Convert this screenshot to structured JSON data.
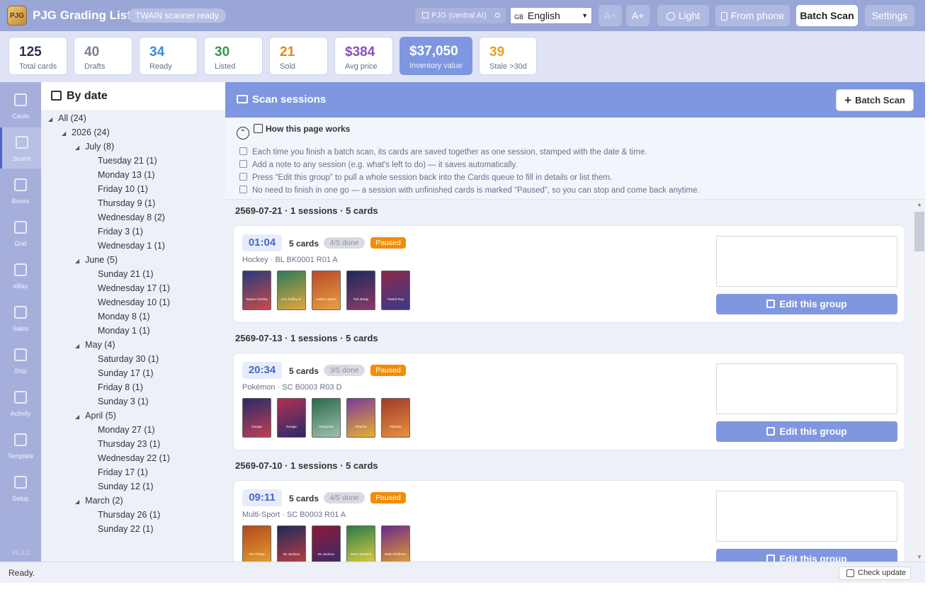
{
  "header": {
    "title": "PJG Grading List",
    "scanner_status": "TWAIN scanner ready",
    "model": "PJG (central AI)",
    "language": {
      "flag": "GB",
      "value": "English"
    },
    "font_decrease": "A−",
    "font_increase": "A+",
    "theme": "Light",
    "from_phone": "From phone",
    "batch_scan": "Batch Scan",
    "settings": "Settings"
  },
  "stats": [
    {
      "value": "125",
      "label": "Total cards",
      "color": "#2d3350"
    },
    {
      "value": "40",
      "label": "Drafts",
      "color": "#7a7f95"
    },
    {
      "value": "34",
      "label": "Ready",
      "color": "#2f8fdc"
    },
    {
      "value": "30",
      "label": "Listed",
      "color": "#2f9a4e"
    },
    {
      "value": "21",
      "label": "Sold",
      "color": "#e8860c"
    },
    {
      "value": "$384",
      "label": "Avg price",
      "color": "#8a4fb5"
    },
    {
      "value": "$37,050",
      "label": "Inventory value",
      "color": "#ffffff"
    },
    {
      "value": "39",
      "label": "Stale >30d",
      "color": "#e8a020"
    }
  ],
  "nav": {
    "items": [
      {
        "label": "Cards",
        "icon": "cards-icon"
      },
      {
        "label": "Scans",
        "icon": "camera-icon"
      },
      {
        "label": "Boxes",
        "icon": "box-icon"
      },
      {
        "label": "Grid",
        "icon": "grid-icon"
      },
      {
        "label": "eBay",
        "icon": "tag-icon"
      },
      {
        "label": "Sales",
        "icon": "sales-icon"
      },
      {
        "label": "Ship",
        "icon": "truck-icon"
      },
      {
        "label": "Activity",
        "icon": "clipboard-icon"
      },
      {
        "label": "Template",
        "icon": "puzzle-icon"
      },
      {
        "label": "Setup",
        "icon": "gear-icon"
      }
    ],
    "active": "Scans",
    "version": "v1.3.1"
  },
  "tree": {
    "title": "By date",
    "nodes": [
      {
        "label": "All (24)",
        "level": 0,
        "expandable": true
      },
      {
        "label": "2026 (24)",
        "level": 1,
        "expandable": true
      },
      {
        "label": "July (8)",
        "level": 2,
        "expandable": true
      },
      {
        "label": "Tuesday 21 (1)",
        "level": 3
      },
      {
        "label": "Monday 13 (1)",
        "level": 3
      },
      {
        "label": "Friday 10 (1)",
        "level": 3
      },
      {
        "label": "Thursday 9 (1)",
        "level": 3
      },
      {
        "label": "Wednesday 8 (2)",
        "level": 3
      },
      {
        "label": "Friday 3 (1)",
        "level": 3
      },
      {
        "label": "Wednesday 1 (1)",
        "level": 3
      },
      {
        "label": "June (5)",
        "level": 2,
        "expandable": true
      },
      {
        "label": "Sunday 21 (1)",
        "level": 3
      },
      {
        "label": "Wednesday 17 (1)",
        "level": 3
      },
      {
        "label": "Wednesday 10 (1)",
        "level": 3
      },
      {
        "label": "Monday 8 (1)",
        "level": 3
      },
      {
        "label": "Monday 1 (1)",
        "level": 3
      },
      {
        "label": "May (4)",
        "level": 2,
        "expandable": true
      },
      {
        "label": "Saturday 30 (1)",
        "level": 3
      },
      {
        "label": "Sunday 17 (1)",
        "level": 3
      },
      {
        "label": "Friday 8 (1)",
        "level": 3
      },
      {
        "label": "Sunday 3 (1)",
        "level": 3
      },
      {
        "label": "April (5)",
        "level": 2,
        "expandable": true
      },
      {
        "label": "Monday 27 (1)",
        "level": 3
      },
      {
        "label": "Thursday 23 (1)",
        "level": 3
      },
      {
        "label": "Wednesday 22 (1)",
        "level": 3
      },
      {
        "label": "Friday 17 (1)",
        "level": 3
      },
      {
        "label": "Sunday 12 (1)",
        "level": 3
      },
      {
        "label": "March (2)",
        "level": 2,
        "expandable": true
      },
      {
        "label": "Thursday 26 (1)",
        "level": 3
      },
      {
        "label": "Sunday 22 (1)",
        "level": 3
      }
    ]
  },
  "main": {
    "title": "Scan sessions",
    "batch_scan": "Batch Scan",
    "howto": {
      "title": "How this page works",
      "lines": [
        "Each time you finish a batch scan, its cards are saved together as one session, stamped with the date & time.",
        "Add a note to any session (e.g. what's left to do) — it saves automatically.",
        "Press “Edit this group” to pull a whole session back into the Cards queue to fill in details or list them.",
        "No need to finish in one go — a session with unfinished cards is marked “Paused”, so you can stop and come back anytime."
      ]
    },
    "groups": [
      {
        "heading": "2569-07-21 · 1 sessions · 5 cards",
        "session": {
          "time": "01:04",
          "count": "5 cards",
          "done": "4/5 done",
          "status": "Paused",
          "meta": "Hockey · BL BK0001 R01 A",
          "thumbs": [
            {
              "name": "Wayne Gretzky",
              "colors": [
                "#2b3a7a",
                "#c94a4a"
              ]
            },
            {
              "name": "Ken Griffey Jr.",
              "colors": [
                "#2f7a5a",
                "#e0a83a"
              ]
            },
            {
              "name": "LeBron James",
              "colors": [
                "#b84a2a",
                "#e8a040"
              ]
            },
            {
              "name": "Tom Brady",
              "colors": [
                "#1e2a5a",
                "#8a3a6a"
              ]
            },
            {
              "name": "Patrick Roy",
              "colors": [
                "#8a2a4a",
                "#3a3a8a"
              ]
            }
          ],
          "edit": "Edit this group"
        }
      },
      {
        "heading": "2569-07-13 · 1 sessions · 5 cards",
        "session": {
          "time": "20:34",
          "count": "5 cards",
          "done": "3/5 done",
          "status": "Paused",
          "meta": "Pokémon · SC B0003 R03 D",
          "thumbs": [
            {
              "name": "Gengar",
              "colors": [
                "#2a2a6a",
                "#c04050"
              ]
            },
            {
              "name": "Gengar",
              "colors": [
                "#b03050",
                "#2a2a6a"
              ]
            },
            {
              "name": "Rayquaza",
              "colors": [
                "#2a6a4a",
                "#a0c0b0"
              ]
            },
            {
              "name": "Pikachu",
              "colors": [
                "#7a3a9a",
                "#e8b030"
              ]
            },
            {
              "name": "Pikachu",
              "colors": [
                "#a03a2a",
                "#e89040"
              ]
            }
          ],
          "edit": "Edit this group"
        }
      },
      {
        "heading": "2569-07-10 · 1 sessions · 5 cards",
        "session": {
          "time": "09:11",
          "count": "5 cards",
          "done": "4/5 done",
          "status": "Paused",
          "meta": "Multi-Sport · SC B0003 R01 A",
          "thumbs": [
            {
              "name": "Jim Thorpe",
              "colors": [
                "#b04a1a",
                "#e8a030"
              ]
            },
            {
              "name": "Bo Jackson",
              "colors": [
                "#1e2a5a",
                "#c04040"
              ]
            },
            {
              "name": "Bo Jackson",
              "colors": [
                "#8a1a3a",
                "#3a2a6a"
              ]
            },
            {
              "name": "Deion Sanders",
              "colors": [
                "#2a7a4a",
                "#e0d040"
              ]
            },
            {
              "name": "Babe Didrikson",
              "colors": [
                "#6a2a8a",
                "#e8a030"
              ]
            }
          ],
          "edit": "Edit this group"
        }
      }
    ]
  },
  "status_bar": {
    "text": "Ready.",
    "check_update": "Check update"
  }
}
